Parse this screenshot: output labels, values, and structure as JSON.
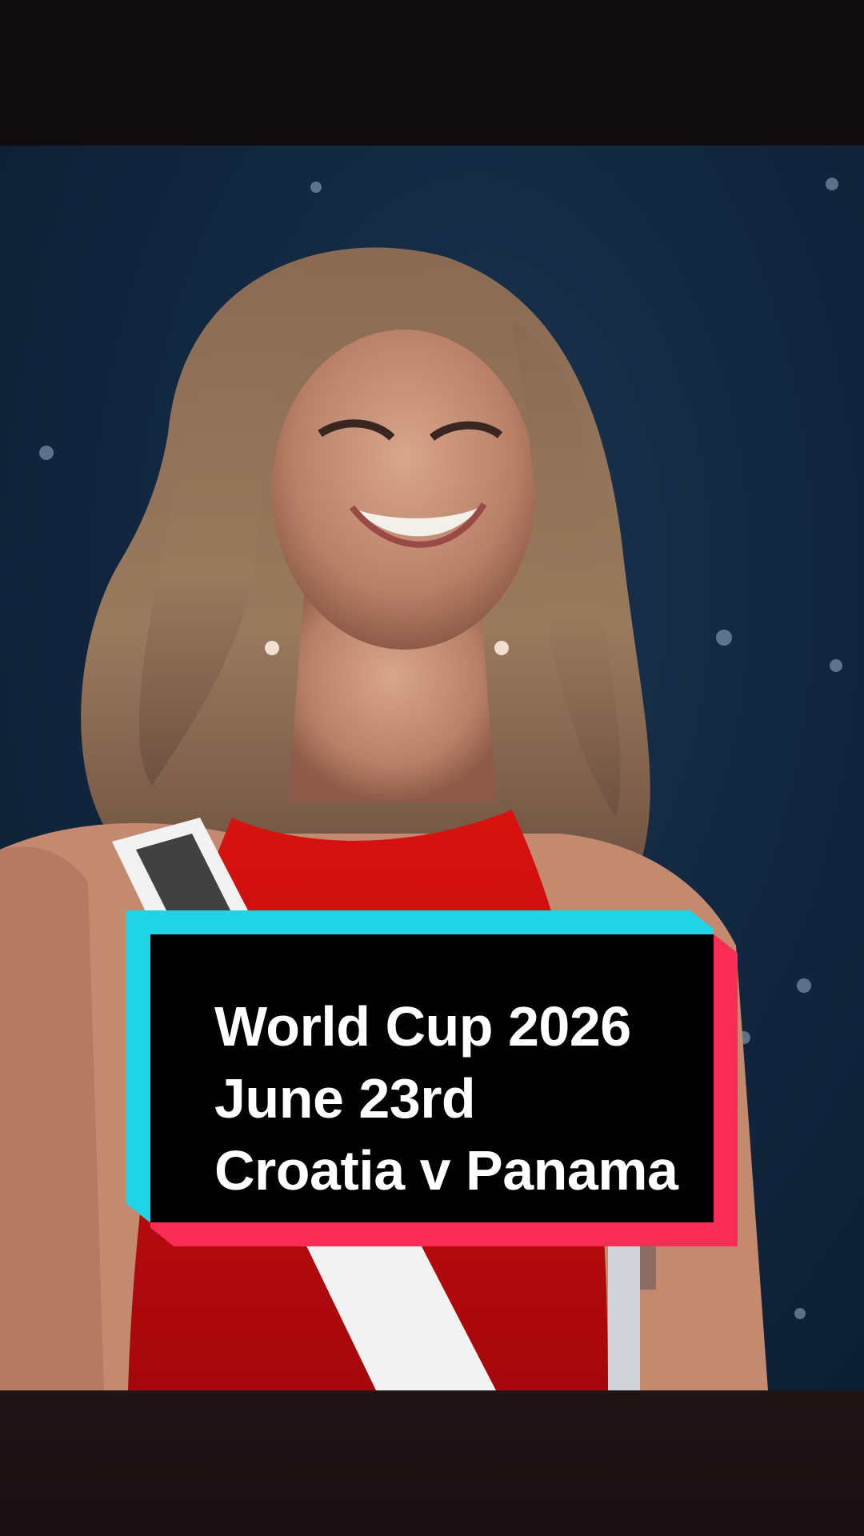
{
  "caption": {
    "lines": [
      "World Cup 2026",
      "June 23rd",
      "Croatia v Panama"
    ]
  },
  "colors": {
    "accent_cyan": "#20d4e8",
    "accent_pink": "#fb2c56",
    "card_background": "#000000",
    "caption_text": "#ffffff",
    "letterbox": "#100d0f"
  },
  "video": {
    "scene": "video-frame"
  }
}
